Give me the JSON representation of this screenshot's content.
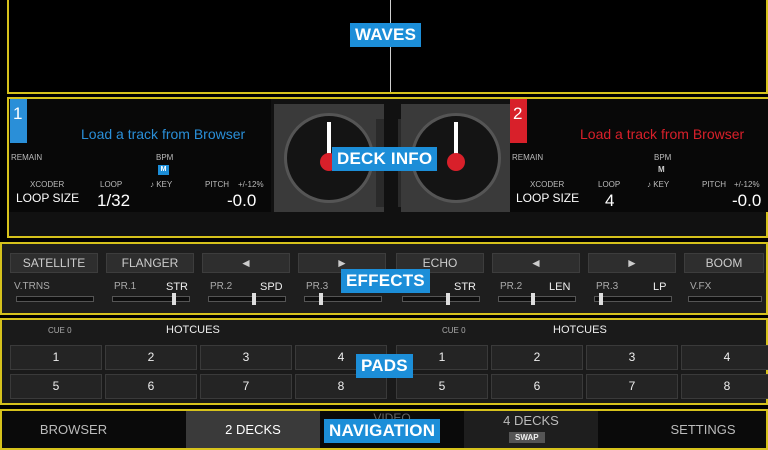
{
  "callouts": {
    "waves": "WAVES",
    "deck_info": "DECK INFO",
    "effects": "EFFECTS",
    "pads": "PADS",
    "navigation": "NAVIGATION"
  },
  "colors": {
    "deck1": "#2a8fd8",
    "deck2": "#d8202a",
    "panel_border": "#d6c21c",
    "callout": "#1c8ed8"
  },
  "decks": [
    {
      "number": "1",
      "load_text": "Load a track from Browser",
      "remain_label": "REMAIN",
      "bpm_label": "BPM",
      "bpm_mode": "M",
      "xcoder_label": "XCODER",
      "loop_label": "LOOP",
      "key_label": "♪ KEY",
      "pitch_label": "PITCH",
      "pitch_range": "+/-12%",
      "loop_size_label": "LOOP SIZE",
      "loop_size": "1/32",
      "pitch_value": "-0.0"
    },
    {
      "number": "2",
      "load_text": "Load a track from Browser",
      "remain_label": "REMAIN",
      "bpm_label": "BPM",
      "bpm_mode": "M",
      "xcoder_label": "XCODER",
      "loop_label": "LOOP",
      "key_label": "♪ KEY",
      "pitch_label": "PITCH",
      "pitch_range": "+/-12%",
      "loop_size_label": "LOOP SIZE",
      "loop_size": "4",
      "pitch_value": "-0.0"
    }
  ],
  "effects": {
    "left": {
      "master_btn": "SATELLITE",
      "master_label": "V.TRNS",
      "fx_btn": "FLANGER",
      "prev": "◄",
      "next": "►",
      "params": [
        {
          "label": "PR.1",
          "name": "STR",
          "level": 0.82
        },
        {
          "label": "PR.2",
          "name": "SPD",
          "level": 0.6
        },
        {
          "label": "PR.3",
          "name": "",
          "level": 0.2
        }
      ]
    },
    "right": {
      "fx_btn": "ECHO",
      "prev": "◄",
      "next": "►",
      "master_btn": "BOOM",
      "master_label": "V.FX",
      "params": [
        {
          "label": "PR.1",
          "name": "STR",
          "level": 0.6
        },
        {
          "label": "PR.2",
          "name": "LEN",
          "level": 0.45
        },
        {
          "label": "PR.3",
          "name": "LP",
          "level": 0.05
        }
      ]
    }
  },
  "pads": {
    "left": {
      "cue_label": "CUE 0",
      "title": "HOTCUES",
      "buttons": [
        "1",
        "2",
        "3",
        "4",
        "5",
        "6",
        "7",
        "8"
      ]
    },
    "right": {
      "cue_label": "CUE 0",
      "title": "HOTCUES",
      "buttons": [
        "1",
        "2",
        "3",
        "4",
        "5",
        "6",
        "7",
        "8"
      ]
    }
  },
  "navigation": {
    "browser": "BROWSER",
    "two_decks": "2 DECKS",
    "video": "VIDEO",
    "four_decks": "4 DECKS",
    "swap": "SWAP",
    "settings": "SETTINGS"
  }
}
